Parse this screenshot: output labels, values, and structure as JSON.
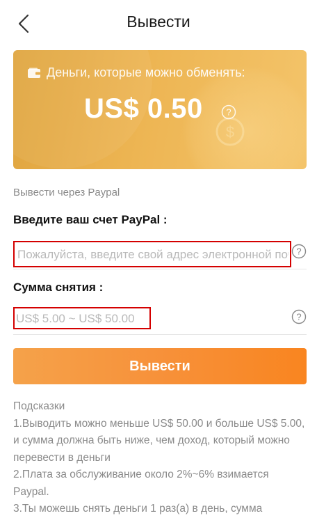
{
  "header": {
    "title": "Вывести",
    "back_icon": "chevron-left-icon"
  },
  "balance_card": {
    "label": "Деньги, которые можно обменять:",
    "amount": "US$ 0.50",
    "wallet_icon": "wallet-icon",
    "help_icon": "question-circle-icon"
  },
  "form": {
    "via_label": "Вывести через Paypal",
    "account_label": "Введите ваш счет PayPal :",
    "account_placeholder": "Пожалуйста, введите свой адрес электронной почты PayPal",
    "account_value": "",
    "amount_label": "Сумма снятия :",
    "amount_placeholder": "US$ 5.00 ~ US$ 50.00",
    "amount_value": "",
    "submit_label": "Вывести"
  },
  "hints": {
    "title": "Подсказки",
    "line1": "1.Выводить можно меньше US$ 50.00 и больше US$ 5.00, и сумма должна быть ниже, чем доход, который можно перевести в деньги",
    "line2": "2.Плата за обслуживание около 2%~6% взимается Paypal.",
    "line3": "3.Ты можешь снять деньги 1 раз(а) в день, сумма"
  },
  "colors": {
    "card_gradient_start": "#e0a53f",
    "card_gradient_end": "#f4c46a",
    "button_start": "#f5a24a",
    "button_end": "#f98520",
    "highlight_border": "#d40000",
    "muted_text": "#8a8a8a"
  }
}
